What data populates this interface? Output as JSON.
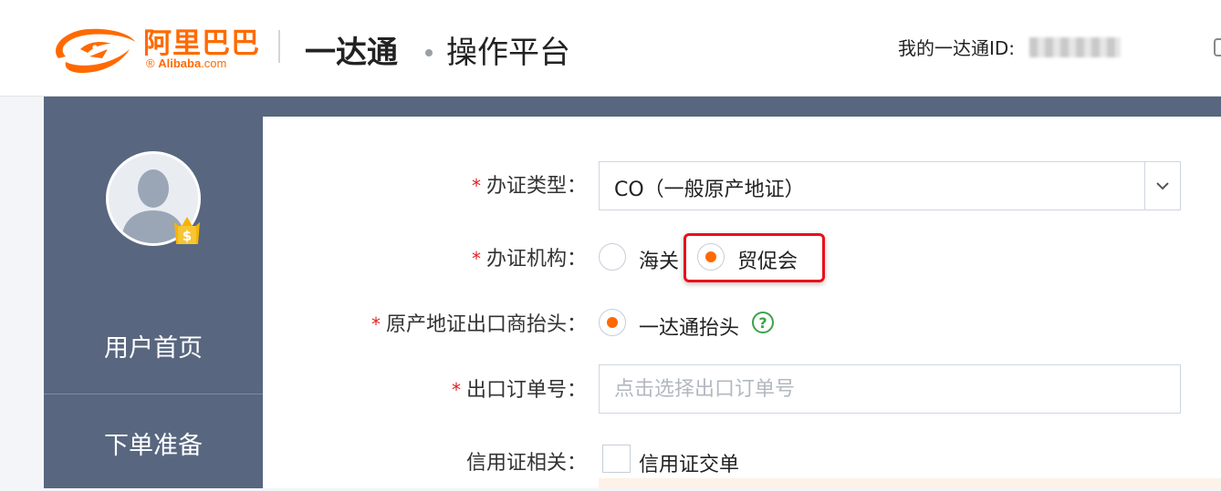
{
  "header": {
    "logo_cn": "阿里巴巴",
    "logo_en_brand": "Alibaba",
    "logo_en_domain": ".com",
    "logo_registered": "®",
    "product": "一达通",
    "platform": "操作平台",
    "user_id_label": "我的一达通ID:"
  },
  "sidebar": {
    "items": [
      {
        "label": "用户首页"
      },
      {
        "label": "下单准备"
      }
    ]
  },
  "form": {
    "required_mark": "*",
    "cert_type": {
      "label": "办证类型：",
      "value": "CO（一般原产地证）"
    },
    "cert_agency": {
      "label": "办证机构：",
      "options": [
        {
          "label": "海关",
          "checked": false
        },
        {
          "label": "贸促会",
          "checked": true
        }
      ]
    },
    "exporter_header": {
      "label": "原产地证出口商抬头：",
      "option": "一达通抬头",
      "checked": true,
      "help": "?"
    },
    "export_order": {
      "label": "出口订单号：",
      "placeholder": "点击选择出口订单号"
    },
    "lc": {
      "label": "信用证相关：",
      "option": "信用证交单",
      "checked": false
    }
  },
  "colors": {
    "accent": "#ff6a00",
    "sidebar": "#58667f",
    "highlight": "#e8101c",
    "help": "#3aa34a"
  }
}
